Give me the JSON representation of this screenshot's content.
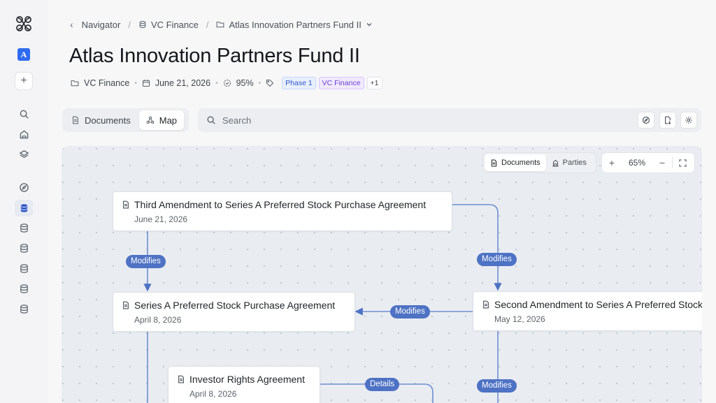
{
  "rail": {
    "avatar_letter": "A",
    "add_label": "+"
  },
  "breadcrumb": {
    "items": [
      {
        "label": "Navigator"
      },
      {
        "label": "VC Finance"
      },
      {
        "label": "Atlas Innovation Partners Fund II"
      }
    ]
  },
  "page": {
    "title": "Atlas Innovation Partners Fund II"
  },
  "meta": {
    "project": "VC Finance",
    "date": "June 21, 2026",
    "progress": "95%",
    "tags": [
      "Phase 1",
      "VC Finance",
      "+1"
    ]
  },
  "view_toggle": {
    "documents_label": "Documents",
    "map_label": "Map",
    "active": "Map"
  },
  "search": {
    "placeholder": "Search"
  },
  "canvas": {
    "mode": {
      "documents_label": "Documents",
      "parties_label": "Parties",
      "active": "Documents"
    },
    "zoom": {
      "value": "65%",
      "plus": "+",
      "minus": "−"
    },
    "nodes": [
      {
        "title": "Third Amendment to Series A Preferred Stock Purchase Agreement",
        "date": "June 21, 2026"
      },
      {
        "title": "Series A Preferred Stock Purchase Agreement",
        "date": "April 8, 2026"
      },
      {
        "title": "Second Amendment to Series A Preferred Stock Purchase Agreement",
        "date": "May 12, 2026"
      },
      {
        "title": "Investor Rights Agreement",
        "date": "April 8, 2026"
      }
    ],
    "edge_labels": [
      "Modifies",
      "Modifies",
      "Modifies",
      "Details",
      "Modifies"
    ]
  },
  "colors": {
    "accent": "#4e72c4",
    "avatar": "#2f6bf0",
    "tag_blue": "#2f56c7",
    "tag_purple": "#6b3fd0"
  }
}
